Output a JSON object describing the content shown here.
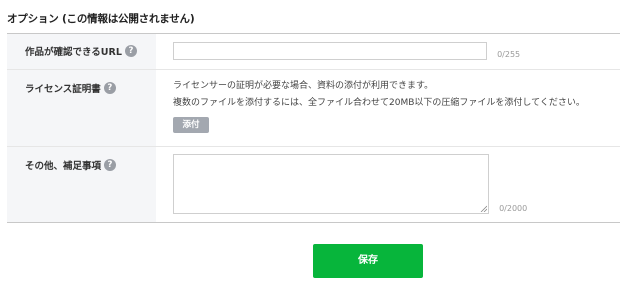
{
  "section": {
    "title": "オプション (この情報は公開されません)"
  },
  "help_icon_glyph": "?",
  "rows": {
    "url": {
      "label": "作品が確認できるURL",
      "input_value": "",
      "counter": "0/255"
    },
    "license": {
      "label": "ライセンス証明書",
      "desc_line1": "ライセンサーの証明が必要な場合、資料の添付が利用できます。",
      "desc_line2": "複数のファイルを添付するには、全ファイル合わせて20MB以下の圧縮ファイルを添付してください。",
      "attach_label": "添付"
    },
    "notes": {
      "label": "その他、補足事項",
      "textarea_value": "",
      "counter": "0/2000"
    }
  },
  "save_label": "保存",
  "colors": {
    "save_button": "#07b53b",
    "attach_button": "#a3a8b0",
    "label_bg": "#f5f6f8",
    "help_icon": "#9a9ea5"
  },
  "icons": {
    "help": "question-circle-icon",
    "resize": "resize-handle-icon"
  }
}
